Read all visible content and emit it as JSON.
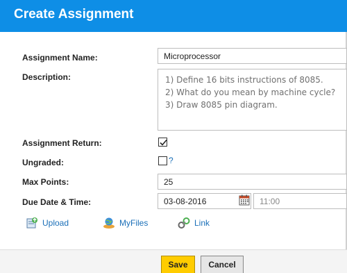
{
  "dialog": {
    "title": "Create Assignment"
  },
  "form": {
    "name_label": "Assignment Name:",
    "name_value": "Microprocessor",
    "description_label": "Description:",
    "description_lines": [
      "1) Define 16 bits instructions of 8085.",
      "2) What do you mean by machine cycle?",
      "3) Draw 8085 pin diagram."
    ],
    "return_label": "Assignment Return:",
    "return_checked": true,
    "ungraded_label": "Ungraded:",
    "ungraded_checked": false,
    "ungraded_help": "?",
    "max_points_label": "Max Points:",
    "max_points_value": "25",
    "due_label": "Due Date & Time:",
    "due_date": "03-08-2016",
    "due_time": "11:00"
  },
  "attachments": {
    "upload_label": "Upload",
    "upload_icon": "upload-icon",
    "myfiles_label": "MyFiles",
    "myfiles_icon": "myfiles-icon",
    "link_label": "Link",
    "link_icon": "link-icon"
  },
  "footer": {
    "save_label": "Save",
    "cancel_label": "Cancel"
  },
  "colors": {
    "header": "#0e8ee6",
    "save_button": "#ffcc00",
    "link_text": "#1a6fb8"
  }
}
